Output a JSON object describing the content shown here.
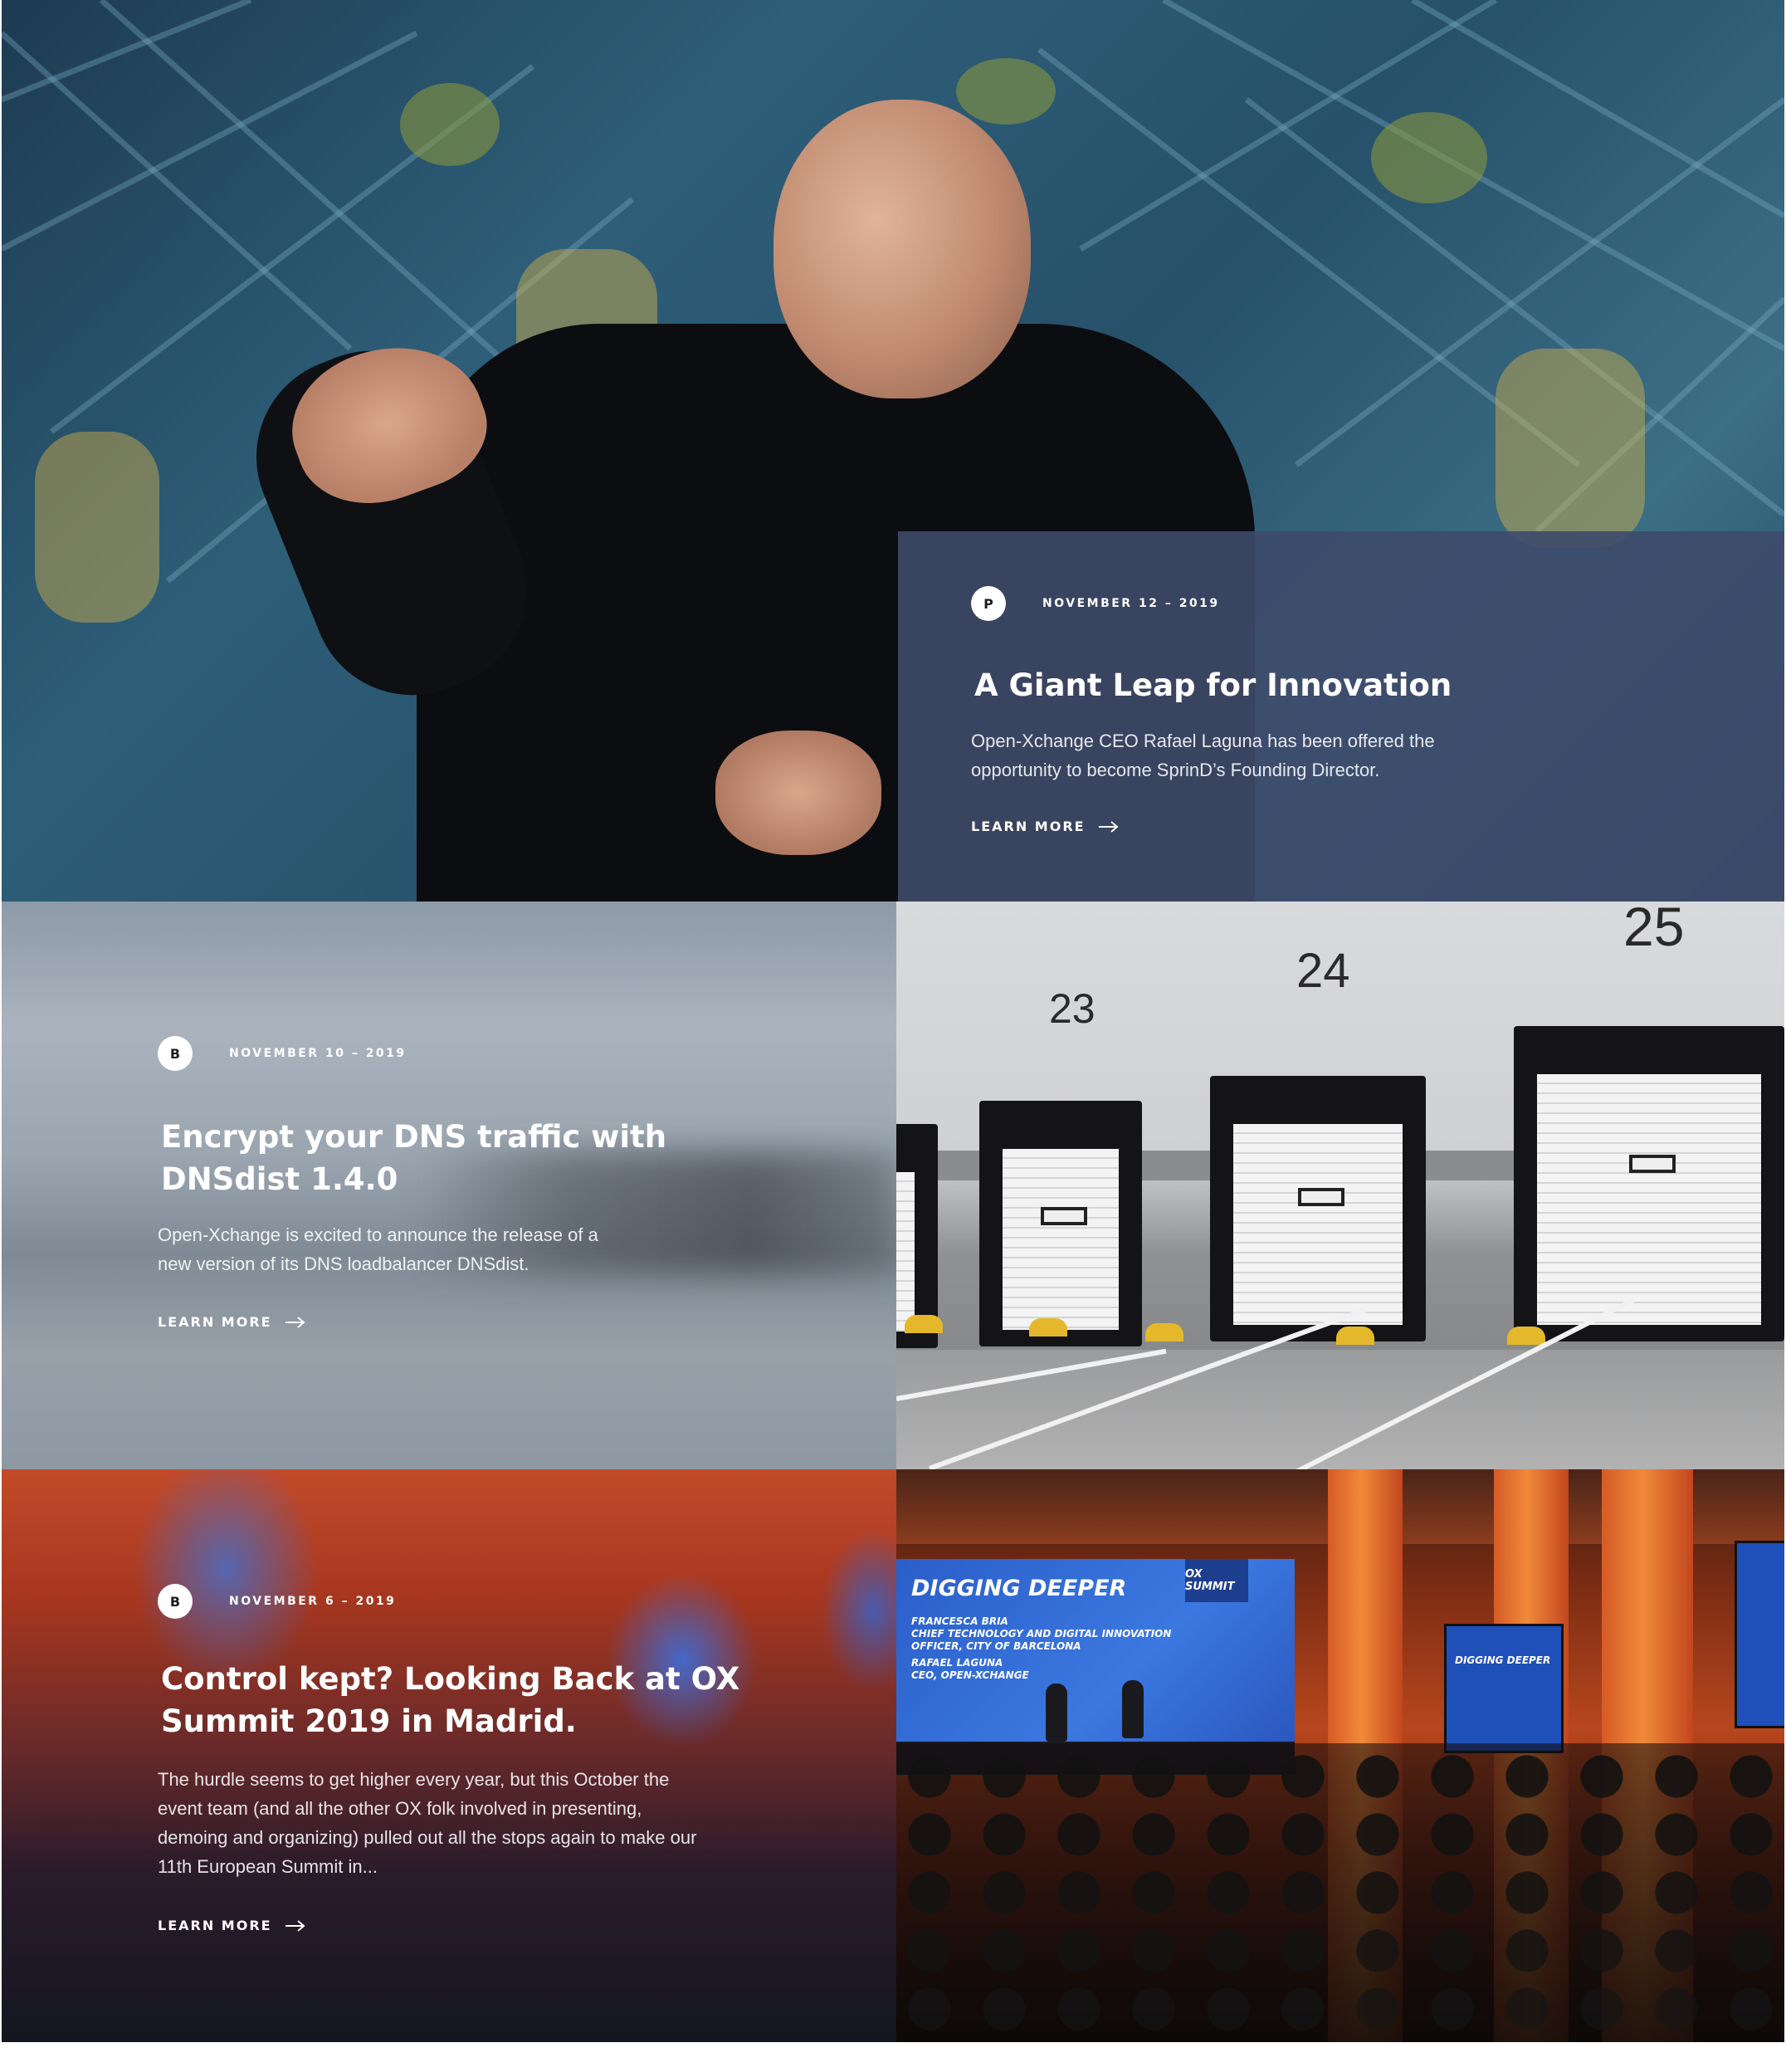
{
  "posts": [
    {
      "badge": "P",
      "date": "NOVEMBER 12 – 2019",
      "title": "A Giant Leap for Innovation",
      "description": "Open-Xchange CEO Rafael Laguna has been offered the opportunity to become SprinD’s Founding Director.",
      "cta": "LEARN MORE"
    },
    {
      "badge": "B",
      "date": "NOVEMBER 10 – 2019",
      "title": "Encrypt your DNS traffic with DNSdist 1.4.0",
      "description": "Open-Xchange is excited to announce the release of a new version of its DNS loadbalancer DNSdist.",
      "cta": "LEARN MORE"
    },
    {
      "badge": "B",
      "date": "NOVEMBER 6 – 2019",
      "title": "Control kept? Looking Back at OX Summit 2019 in Madrid.",
      "description": "The hurdle seems to get higher every year, but this October the event team (and all the other OX folk involved in presenting, demoing and organizing) pulled out all the stops again to make our 11th European Summit in...",
      "cta": "LEARN MORE"
    }
  ],
  "warehouse_photo": {
    "dock_numbers": [
      "23",
      "24",
      "25"
    ]
  },
  "summit_photo": {
    "screen_headline": "DIGGING DEEPER",
    "screen_lines": [
      "FRANCESCA BRIA",
      "CHIEF TECHNOLOGY AND DIGITAL INNOVATION",
      "OFFICER, CITY OF BARCELONA",
      "RAFAEL LAGUNA",
      "CEO, OPEN-XCHANGE"
    ],
    "screen_logo": "OX SUMMIT",
    "side_screen_headline": "DIGGING DEEPER"
  },
  "colors": {
    "hero_card_bg": "#3e4a6a",
    "text": "#ffffff",
    "badge_bg": "#ffffff"
  }
}
